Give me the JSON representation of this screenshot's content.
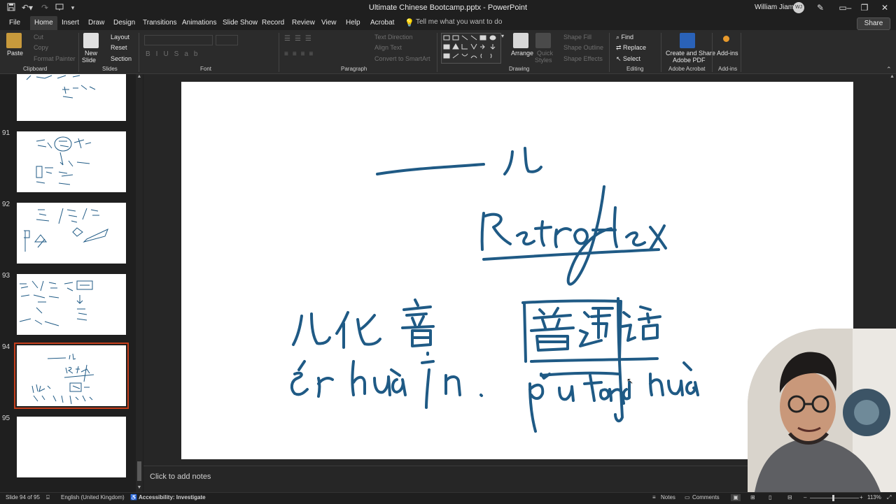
{
  "titlebar": {
    "title": "Ultimate Chinese Bootcamp.pptx  -  PowerPoint",
    "user": "William Jiamin",
    "avatar": "WJ",
    "quick_access": [
      "save-icon",
      "undo-icon",
      "redo-icon",
      "present-icon",
      "customize-icon"
    ]
  },
  "tabs": [
    "File",
    "Home",
    "Insert",
    "Draw",
    "Design",
    "Transitions",
    "Animations",
    "Slide Show",
    "Record",
    "Review",
    "View",
    "Help",
    "Acrobat"
  ],
  "active_tab": "Home",
  "tell_me": "Tell me what you want to do",
  "share": "Share",
  "ribbon": {
    "clipboard": {
      "paste": "Paste",
      "cut": "Cut",
      "copy": "Copy",
      "format_painter": "Format Painter",
      "label": "Clipboard"
    },
    "slides": {
      "new_slide": "New",
      "new_slide2": "Slide",
      "layout": "Layout",
      "reset": "Reset",
      "section": "Section",
      "label": "Slides"
    },
    "font": {
      "label": "Font"
    },
    "paragraph": {
      "text_direction": "Text Direction",
      "align_text": "Align Text",
      "convert": "Convert to SmartArt",
      "label": "Paragraph"
    },
    "drawing": {
      "arrange": "Arrange",
      "quick_styles": "Quick",
      "quick_styles2": "Styles",
      "shape_fill": "Shape Fill",
      "shape_outline": "Shape Outline",
      "shape_effects": "Shape Effects",
      "label": "Drawing"
    },
    "editing": {
      "find": "Find",
      "replace": "Replace",
      "select": "Select",
      "label": "Editing"
    },
    "acrobat": {
      "create": "Create and Share",
      "create2": "Adobe PDF",
      "label": "Adobe Acrobat"
    },
    "addins": {
      "button": "Add-ins",
      "label": "Add-ins"
    }
  },
  "thumbnails": [
    {
      "number": "",
      "selected": false
    },
    {
      "number": "91",
      "selected": false
    },
    {
      "number": "92",
      "selected": false
    },
    {
      "number": "93",
      "selected": false
    },
    {
      "number": "94",
      "selected": true
    },
    {
      "number": "95",
      "selected": false
    }
  ],
  "slide": {
    "handwriting": {
      "top": "一儿",
      "word": "Retroflex",
      "hanzi_left": "儿化音",
      "pinyin_left": "ér huà yīn.",
      "hanzi_right": "普通话",
      "pinyin_right": "pǔ tōng huà."
    }
  },
  "notes": {
    "placeholder": "Click to add notes"
  },
  "status": {
    "slide": "Slide 94 of 95",
    "language": "English (United Kingdom)",
    "accessibility": "Accessibility: Investigate",
    "notes": "Notes",
    "comments": "Comments",
    "zoom": "113%"
  },
  "colors": {
    "ink": "#1f5a85",
    "accent": "#c43e1c",
    "background": "#1f1f1f"
  }
}
